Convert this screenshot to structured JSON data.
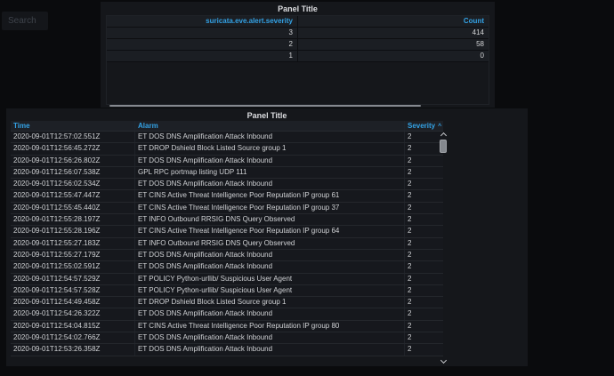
{
  "colors": {
    "page_background": "#0a0b0d",
    "panel_background": "#15171b",
    "link_blue": "#33a2e5",
    "text": "#d8d9da",
    "scrollbar_thumb": "#84888e"
  },
  "search": {
    "placeholder": "Search"
  },
  "top_panel": {
    "title": "Panel Title",
    "table": {
      "columns": [
        "suricata.eve.alert.severity",
        "Count"
      ],
      "rows": [
        [
          "3",
          "414"
        ],
        [
          "2",
          "58"
        ],
        [
          "1",
          "0"
        ]
      ]
    }
  },
  "bottom_panel": {
    "title": "Panel Title",
    "columns": {
      "time": "Time",
      "alarm": "Alarm",
      "severity": "Severity"
    },
    "sort_indicator": "^",
    "rows": [
      [
        "2020-09-01T12:57:02.551Z",
        "ET DOS DNS Amplification Attack Inbound",
        "2"
      ],
      [
        "2020-09-01T12:56:45.272Z",
        "ET DROP Dshield Block Listed Source group 1",
        "2"
      ],
      [
        "2020-09-01T12:56:26.802Z",
        "ET DOS DNS Amplification Attack Inbound",
        "2"
      ],
      [
        "2020-09-01T12:56:07.538Z",
        "GPL RPC portmap listing UDP 111",
        "2"
      ],
      [
        "2020-09-01T12:56:02.534Z",
        "ET DOS DNS Amplification Attack Inbound",
        "2"
      ],
      [
        "2020-09-01T12:55:47.447Z",
        "ET CINS Active Threat Intelligence Poor Reputation IP group 61",
        "2"
      ],
      [
        "2020-09-01T12:55:45.440Z",
        "ET CINS Active Threat Intelligence Poor Reputation IP group 37",
        "2"
      ],
      [
        "2020-09-01T12:55:28.197Z",
        "ET INFO Outbound RRSIG DNS Query Observed",
        "2"
      ],
      [
        "2020-09-01T12:55:28.196Z",
        "ET CINS Active Threat Intelligence Poor Reputation IP group 64",
        "2"
      ],
      [
        "2020-09-01T12:55:27.183Z",
        "ET INFO Outbound RRSIG DNS Query Observed",
        "2"
      ],
      [
        "2020-09-01T12:55:27.179Z",
        "ET DOS DNS Amplification Attack Inbound",
        "2"
      ],
      [
        "2020-09-01T12:55:02.591Z",
        "ET DOS DNS Amplification Attack Inbound",
        "2"
      ],
      [
        "2020-09-01T12:54:57.529Z",
        "ET POLICY Python-urllib/ Suspicious User Agent",
        "2"
      ],
      [
        "2020-09-01T12:54:57.528Z",
        "ET POLICY Python-urllib/ Suspicious User Agent",
        "2"
      ],
      [
        "2020-09-01T12:54:49.458Z",
        "ET DROP Dshield Block Listed Source group 1",
        "2"
      ],
      [
        "2020-09-01T12:54:26.322Z",
        "ET DOS DNS Amplification Attack Inbound",
        "2"
      ],
      [
        "2020-09-01T12:54:04.815Z",
        "ET CINS Active Threat Intelligence Poor Reputation IP group 80",
        "2"
      ],
      [
        "2020-09-01T12:54:02.766Z",
        "ET DOS DNS Amplification Attack Inbound",
        "2"
      ],
      [
        "2020-09-01T12:53:26.358Z",
        "ET DOS DNS Amplification Attack Inbound",
        "2"
      ]
    ]
  }
}
